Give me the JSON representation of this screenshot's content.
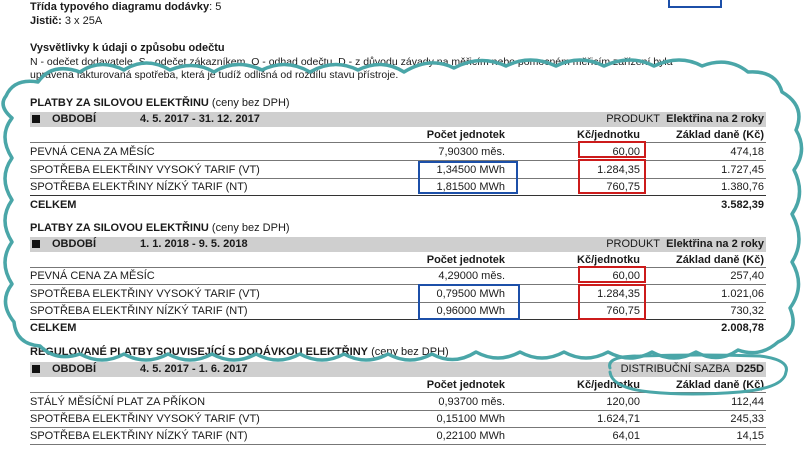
{
  "top": {
    "diagram_label": "Třída typového diagramu dodávky",
    "diagram_value": "5",
    "breaker_label": "Jistič:",
    "breaker_value": "3 x 25A"
  },
  "legend": {
    "title": "Vysvětlivky k údaji o způsobu odečtu",
    "line1": "N - odečet dodavatele, S - odečet zákazníkem, O - odhad odečtu, D - z důvodu závady na měřicím nebo pomocném měřicím zařízení byla",
    "line2": "upravena fakturovaná spotřeba, která je tudíž odlišná od rozdílu stavu přístroje."
  },
  "sections": [
    {
      "title_bold": "PLATBY ZA SILOVOU ELEKTŘINU",
      "title_note": "(ceny bez DPH)",
      "period_label": "OBDOBÍ",
      "period": "4. 5. 2017 - 31. 12. 2017",
      "product_label": "PRODUKT",
      "product": "Elektřina na 2 roky",
      "col_units": "Počet jednotek",
      "col_price": "Kč/jednotku",
      "col_base": "Základ daně (Kč)",
      "rows": [
        {
          "name": "PEVNÁ CENA ZA MĚSÍC",
          "units": "7,90300 měs.",
          "price": "60,00",
          "base": "474,18"
        },
        {
          "name": "SPOTŘEBA ELEKTŘINY VYSOKÝ TARIF (VT)",
          "units": "1,34500 MWh",
          "price": "1.284,35",
          "base": "1.727,45"
        },
        {
          "name": "SPOTŘEBA ELEKTŘINY NÍZKÝ TARIF (NT)",
          "units": "1,81500 MWh",
          "price": "760,75",
          "base": "1.380,76"
        }
      ],
      "total_label": "CELKEM",
      "total": "3.582,39"
    },
    {
      "title_bold": "PLATBY ZA SILOVOU ELEKTŘINU",
      "title_note": "(ceny bez DPH)",
      "period_label": "OBDOBÍ",
      "period": "1. 1. 2018 - 9. 5. 2018",
      "product_label": "PRODUKT",
      "product": "Elektřina na 2 roky",
      "col_units": "Počet jednotek",
      "col_price": "Kč/jednotku",
      "col_base": "Základ daně (Kč)",
      "rows": [
        {
          "name": "PEVNÁ CENA ZA MĚSÍC",
          "units": "4,29000 měs.",
          "price": "60,00",
          "base": "257,40"
        },
        {
          "name": "SPOTŘEBA ELEKTŘINY VYSOKÝ TARIF (VT)",
          "units": "0,79500 MWh",
          "price": "1.284,35",
          "base": "1.021,06"
        },
        {
          "name": "SPOTŘEBA ELEKTŘINY NÍZKÝ TARIF (NT)",
          "units": "0,96000 MWh",
          "price": "760,75",
          "base": "730,32"
        }
      ],
      "total_label": "CELKEM",
      "total": "2.008,78"
    },
    {
      "title_bold": "REGULOVANÉ PLATBY SOUVISEJÍCÍ S DODÁVKOU ELEKTŘINY",
      "title_note": "(ceny bez DPH)",
      "period_label": "OBDOBÍ",
      "period": "4. 5. 2017 - 1. 6. 2017",
      "product_label": "DISTRIBUČNÍ SAZBA",
      "product": "D25D",
      "col_units": "Počet jednotek",
      "col_price": "Kč/jednotku",
      "col_base": "Základ daně (Kč)",
      "rows": [
        {
          "name": "STÁLÝ MĚSÍČNÍ PLAT ZA PŘÍKON",
          "units": "0,93700 měs.",
          "price": "120,00",
          "base": "112,44"
        },
        {
          "name": "SPOTŘEBA ELEKTŘINY VYSOKÝ TARIF (VT)",
          "units": "0,15100 MWh",
          "price": "1.624,71",
          "base": "245,33"
        },
        {
          "name": "SPOTŘEBA ELEKTŘINY NÍZKÝ TARIF (NT)",
          "units": "0,22100 MWh",
          "price": "64,01",
          "base": "14,15"
        }
      ]
    }
  ],
  "colors": {
    "highlight_blue": "#1c4fa8",
    "highlight_red": "#cc1b1b",
    "cloud_teal": "#4aa6a8",
    "header_gray": "#cfcfcf"
  }
}
